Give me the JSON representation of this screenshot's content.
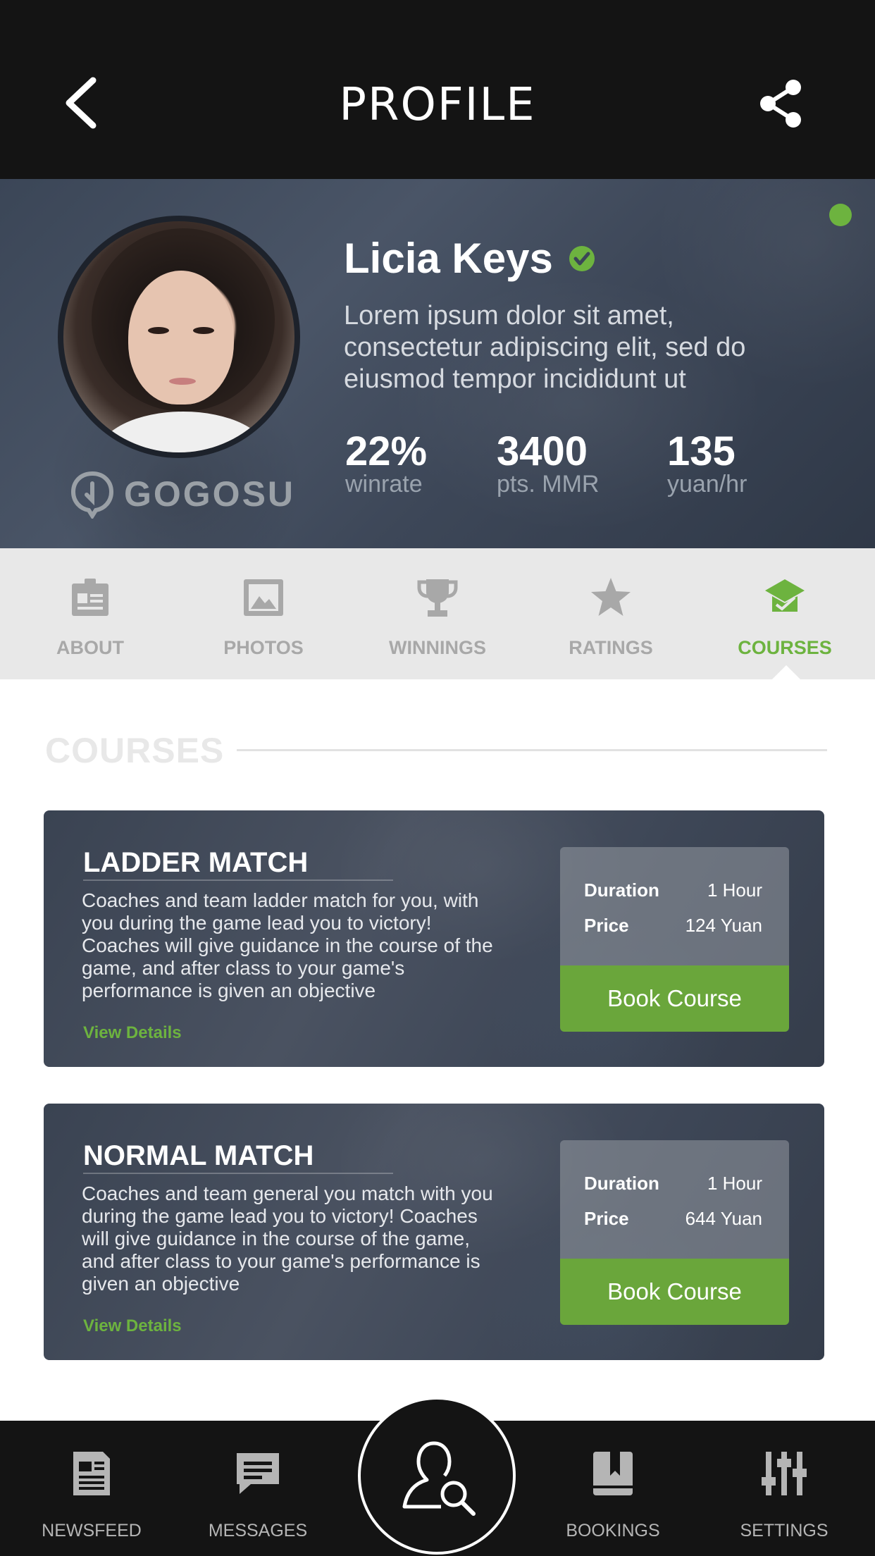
{
  "header": {
    "title": "PROFILE",
    "back_icon": "chevron-left-icon",
    "share_icon": "share-icon"
  },
  "profile": {
    "name": "Licia Keys",
    "verified": true,
    "online": true,
    "bio": "Lorem ipsum dolor sit amet, consectetur adipiscing elit, sed do eiusmod tempor incididunt ut",
    "brand": "GOGOSU",
    "stats": [
      {
        "value": "22%",
        "label": "winrate"
      },
      {
        "value": "3400",
        "label": "pts. MMR"
      },
      {
        "value": "135",
        "label": "yuan/hr"
      }
    ]
  },
  "tabs": [
    {
      "label": "ABOUT",
      "icon": "clipboard-icon",
      "active": false
    },
    {
      "label": "PHOTOS",
      "icon": "image-icon",
      "active": false
    },
    {
      "label": "WINNINGS",
      "icon": "trophy-icon",
      "active": false
    },
    {
      "label": "RATINGS",
      "icon": "star-icon",
      "active": false
    },
    {
      "label": "COURSES",
      "icon": "graduation-cap-icon",
      "active": true
    }
  ],
  "section": {
    "title": "COURSES"
  },
  "courses": [
    {
      "title": "LADDER MATCH",
      "description": "Coaches and team ladder match for you, with you during the game lead you to victory! Coaches will give guidance in the course of the game, and after class to your game's performance is given an objective",
      "view_details": "View Details",
      "duration_label": "Duration",
      "duration": "1 Hour",
      "price_label": "Price",
      "price": "124 Yuan",
      "button": "Book Course"
    },
    {
      "title": "NORMAL MATCH",
      "description": "Coaches and team general you match with you during the game lead you to victory! Coaches will give guidance in the course of the game, and after class to your game's performance is given an objective",
      "view_details": "View Details",
      "duration_label": "Duration",
      "duration": "1 Hour",
      "price_label": "Price",
      "price": "644 Yuan",
      "button": "Book Course"
    }
  ],
  "bottom_nav": [
    {
      "label": "NEWSFEED",
      "icon": "newspaper-icon"
    },
    {
      "label": "MESSAGES",
      "icon": "message-icon"
    },
    {
      "label": "",
      "icon": "user-search-icon"
    },
    {
      "label": "BOOKINGS",
      "icon": "bookmark-book-icon"
    },
    {
      "label": "SETTINGS",
      "icon": "sliders-icon"
    }
  ],
  "colors": {
    "accent": "#6db33f",
    "header_bg": "#141414",
    "banner_bg": "#424c5d",
    "tab_bg": "#e8e8e8"
  }
}
